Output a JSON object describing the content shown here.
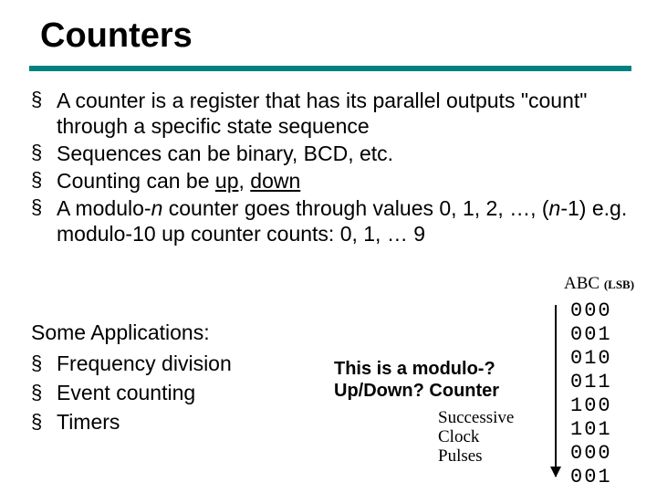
{
  "title": "Counters",
  "bullets": {
    "b1_pre": "A counter is a register that has its parallel outputs \"count\" through a specific state sequence",
    "b2": "Sequences can be binary, BCD, etc.",
    "b3_pre": "Counting can be ",
    "b3_up": "up",
    "b3_mid": ", ",
    "b3_down": "down",
    "b4_pre": "A modulo-",
    "b4_n1": "n",
    "b4_mid": " counter goes through values 0, 1, 2, …, (",
    "b4_n2": "n",
    "b4_post": "-1) e.g. modulo-10 up counter counts: 0, 1, … 9"
  },
  "apps": {
    "heading": "Some Applications:",
    "a1": "Frequency division",
    "a2": "Event counting",
    "a3": "Timers"
  },
  "question": {
    "line1": "This is a modulo-?",
    "line2": "Up/Down? Counter"
  },
  "pulses": {
    "l1": "Successive",
    "l2": "Clock",
    "l3": "Pulses"
  },
  "column": {
    "head": "ABC ",
    "lsb": "(LSB)",
    "rows": [
      "000",
      "001",
      "010",
      "011",
      "100",
      "101",
      "000",
      "001"
    ]
  }
}
